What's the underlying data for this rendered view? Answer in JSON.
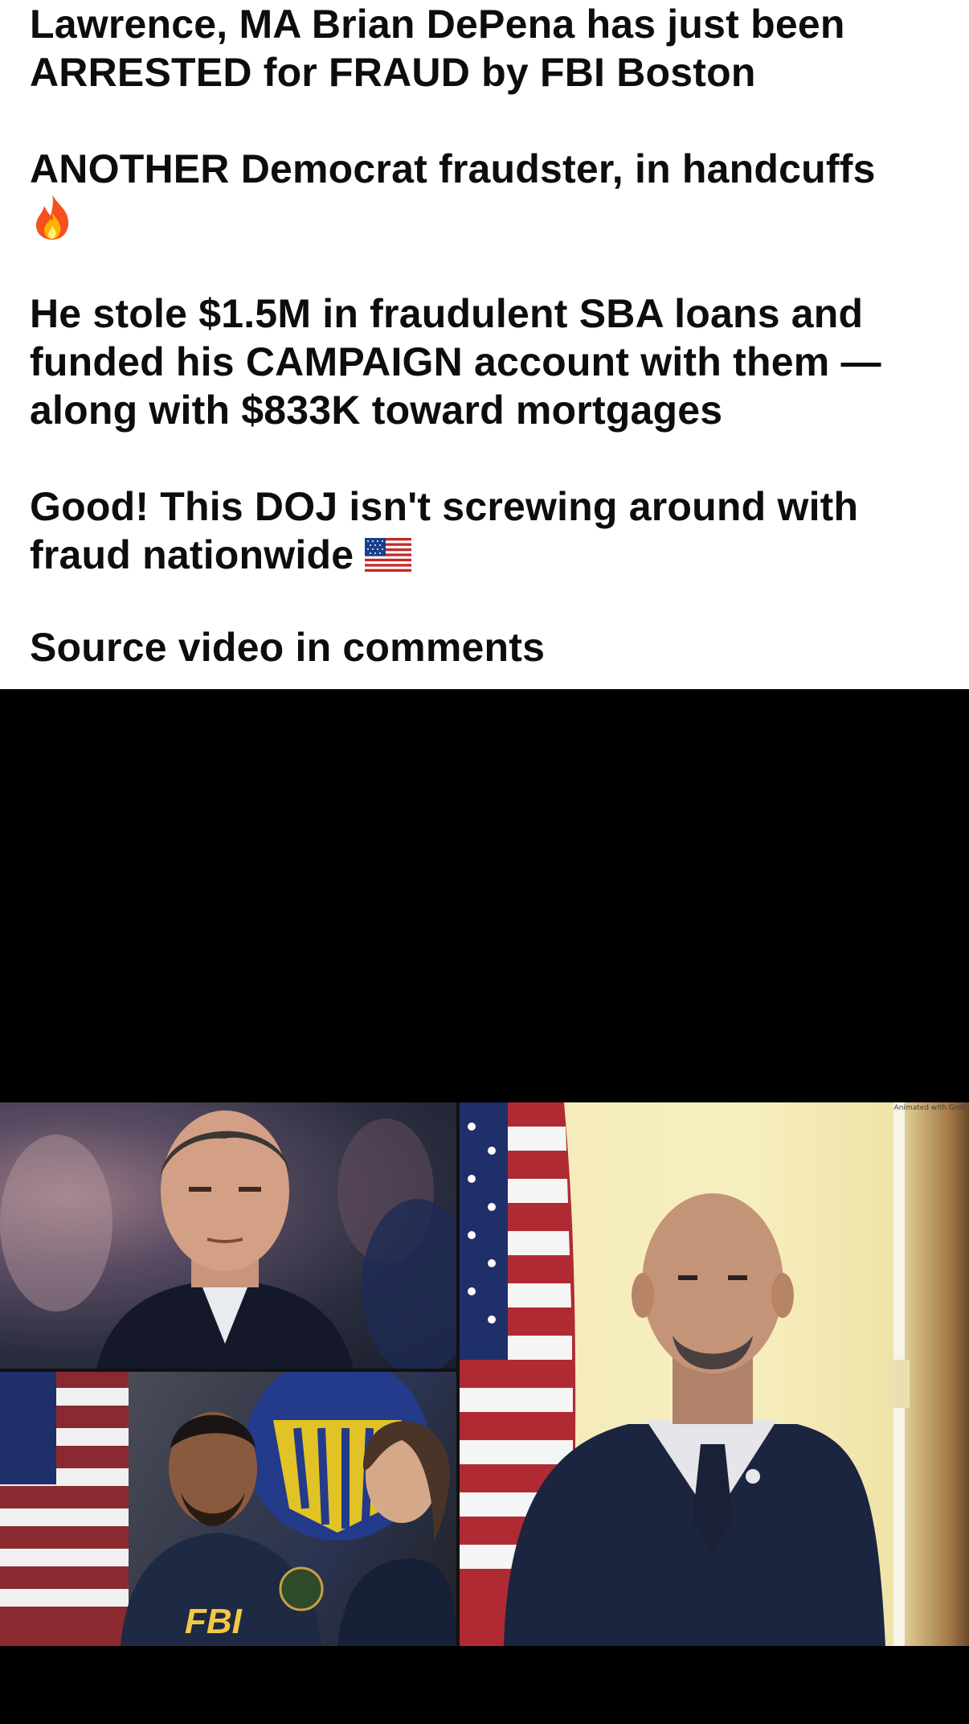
{
  "post": {
    "paragraph_1": "Lawrence, MA Brian DePena has just been ARRESTED for FRAUD by FBI Boston",
    "paragraph_2": "ANOTHER Democrat fraudster, in handcuffs",
    "paragraph_2_emoji": "fire-emoji",
    "paragraph_3": "He stole $1.5M in fraudulent SBA loans and funded his CAMPAIGN account with them — along with $833K toward mortgages",
    "paragraph_4": "Good! This DOJ isn't screwing around with fraud nationwide",
    "paragraph_4_emoji": "us-flag-emoji",
    "paragraph_5": "Source video in comments"
  },
  "media": {
    "collage_caption": "Animated with Grok",
    "badge_text": "FBI"
  },
  "colors": {
    "text": "#0d0d0d",
    "media_background": "#000000",
    "page_background": "#ffffff"
  }
}
